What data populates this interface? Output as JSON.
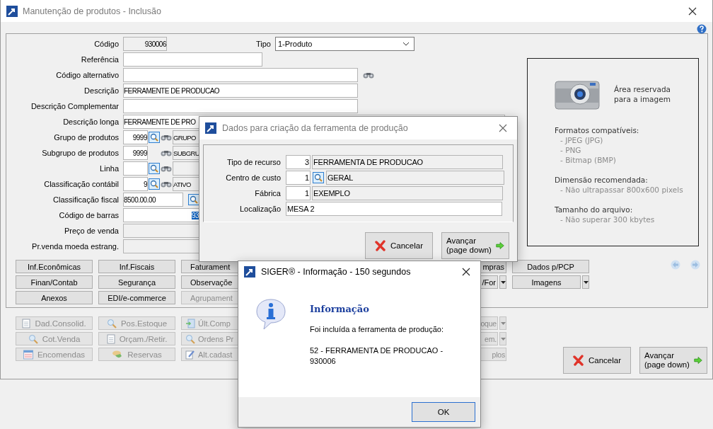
{
  "window": {
    "title": "Manutenção de produtos - Inclusão"
  },
  "tipo": {
    "label": "Tipo",
    "value": "1-Produto"
  },
  "form": [
    {
      "label": "Código",
      "kind": "readonly",
      "value": "930006"
    },
    {
      "label": "Referência",
      "kind": "text"
    },
    {
      "label": "Código alternativo",
      "kind": "search"
    },
    {
      "label": "Descrição",
      "kind": "text",
      "value": "FERRAMENTE DE PRODUCAO"
    },
    {
      "label": "Descrição Complementar",
      "kind": "text"
    },
    {
      "label": "Descrição longa",
      "kind": "text",
      "value": "FERRAMENTE DE PRO"
    },
    {
      "label": "Grupo de produtos",
      "kind": "lookup",
      "code": "9999",
      "lookup_button": true,
      "name": "GRUPO"
    },
    {
      "label": "Subgrupo de produtos",
      "kind": "lookup",
      "code": "9999",
      "lookup_button": false,
      "name": "SUBGRU"
    },
    {
      "label": "Linha",
      "kind": "lookup",
      "lookup_button": true
    },
    {
      "label": "Classificação contábil",
      "kind": "lookup",
      "code": "9",
      "lookup_button": true,
      "name": "ATIVO"
    },
    {
      "label": "Classificação fiscal",
      "kind": "fiscal",
      "value": "8500.00.00"
    },
    {
      "label": "Código de barras",
      "kind": "selected",
      "value": "93"
    },
    {
      "label": "Preço de venda",
      "kind": "disabled"
    },
    {
      "label": "Pr.venda moeda estrang.",
      "kind": "disabled"
    }
  ],
  "image_area": {
    "title": "Área reservada para a imagem",
    "sections": [
      {
        "heading": "Formatos compatíveis:",
        "items": [
          "- JPEG (JPG)",
          "- PNG",
          "- Bitmap (BMP)"
        ]
      },
      {
        "heading": "Dimensão recomendada:",
        "items": [
          "- Não ultrapassar 800x600 pixels"
        ]
      },
      {
        "heading": "Tamanho do arquivo:",
        "items": [
          "- Não superar 300 kbytes"
        ]
      }
    ]
  },
  "tab_buttons": [
    [
      {
        "label": "Inf.Econômicas",
        "disabled": false,
        "dropdown": false
      },
      {
        "label": "Inf.Fiscais",
        "disabled": false,
        "dropdown": false
      },
      {
        "label": "Faturament",
        "disabled": false,
        "dropdown": false
      },
      {
        "label": "mpras",
        "disabled": false,
        "dropdown": false
      },
      {
        "label": "Dados p/PCP",
        "disabled": false,
        "dropdown": false
      }
    ],
    [
      {
        "label": "Finan/Contab",
        "disabled": false,
        "dropdown": false
      },
      {
        "label": "Segurança",
        "disabled": false,
        "dropdown": false
      },
      {
        "label": "Observaçõe",
        "disabled": false,
        "dropdown": false
      },
      {
        "label": "/For",
        "disabled": false,
        "dropdown": true
      },
      {
        "label": "Imagens",
        "disabled": false,
        "dropdown": true
      }
    ],
    [
      {
        "label": "Anexos",
        "disabled": false,
        "dropdown": false
      },
      {
        "label": "EDI/e-commerce",
        "disabled": false,
        "dropdown": false
      },
      {
        "label": "Agrupament",
        "disabled": true,
        "dropdown": false
      }
    ]
  ],
  "action_buttons": [
    [
      {
        "label": "Dad.Consolid.",
        "disabled": true,
        "dropdown": false
      },
      {
        "label": "Pos.Estoque",
        "disabled": true,
        "dropdown": false
      },
      {
        "label": "Últ.Comp",
        "disabled": true,
        "dropdown": false
      },
      {
        "label": "oque",
        "disabled": true,
        "dropdown": true
      }
    ],
    [
      {
        "label": "Cot.Venda",
        "disabled": true,
        "dropdown": false
      },
      {
        "label": "Orçam./Retir.",
        "disabled": true,
        "dropdown": false
      },
      {
        "label": "Ordens Pr",
        "disabled": true,
        "dropdown": false
      },
      {
        "label": "em.",
        "disabled": true,
        "dropdown": true
      }
    ],
    [
      {
        "label": "Encomendas",
        "disabled": true,
        "dropdown": false
      },
      {
        "label": "Reservas",
        "disabled": true,
        "dropdown": false
      },
      {
        "label": "Alt.cadast",
        "disabled": true,
        "dropdown": false
      },
      {
        "label": "plos",
        "disabled": true,
        "dropdown": false
      }
    ]
  ],
  "footer_buttons": [
    {
      "kind": "cancel",
      "label": "Cancelar"
    },
    {
      "kind": "next",
      "label": "Avançar\n(page down)"
    }
  ],
  "tool_dialog": {
    "title": "Dados para criação da ferramenta de produção",
    "fields": [
      {
        "label": "Tipo de recurso",
        "kind": "lookup",
        "code": "3",
        "lookup_button": false,
        "name": "FERRAMENTA DE PRODUCAO"
      },
      {
        "label": "Centro de custo",
        "kind": "lookup",
        "code": "1",
        "lookup_button": true,
        "name": "GERAL"
      },
      {
        "label": "Fábrica",
        "kind": "lookup",
        "code": "1",
        "lookup_button": false,
        "name": "EXEMPLO"
      },
      {
        "label": "Localização",
        "kind": "text",
        "value": "MESA 2"
      }
    ],
    "buttons": [
      {
        "kind": "cancel",
        "label": "Cancelar"
      },
      {
        "kind": "next",
        "label": "Avançar\n(page down)"
      }
    ]
  },
  "info_dialog": {
    "title": "SIGER® - Informação -  150 segundos",
    "heading": "Informação",
    "lines": [
      "Foi incluída a ferramenta de produção:",
      "52 - FERRAMENTA DE PRODUCAO -\n930006"
    ],
    "button": "OK"
  }
}
